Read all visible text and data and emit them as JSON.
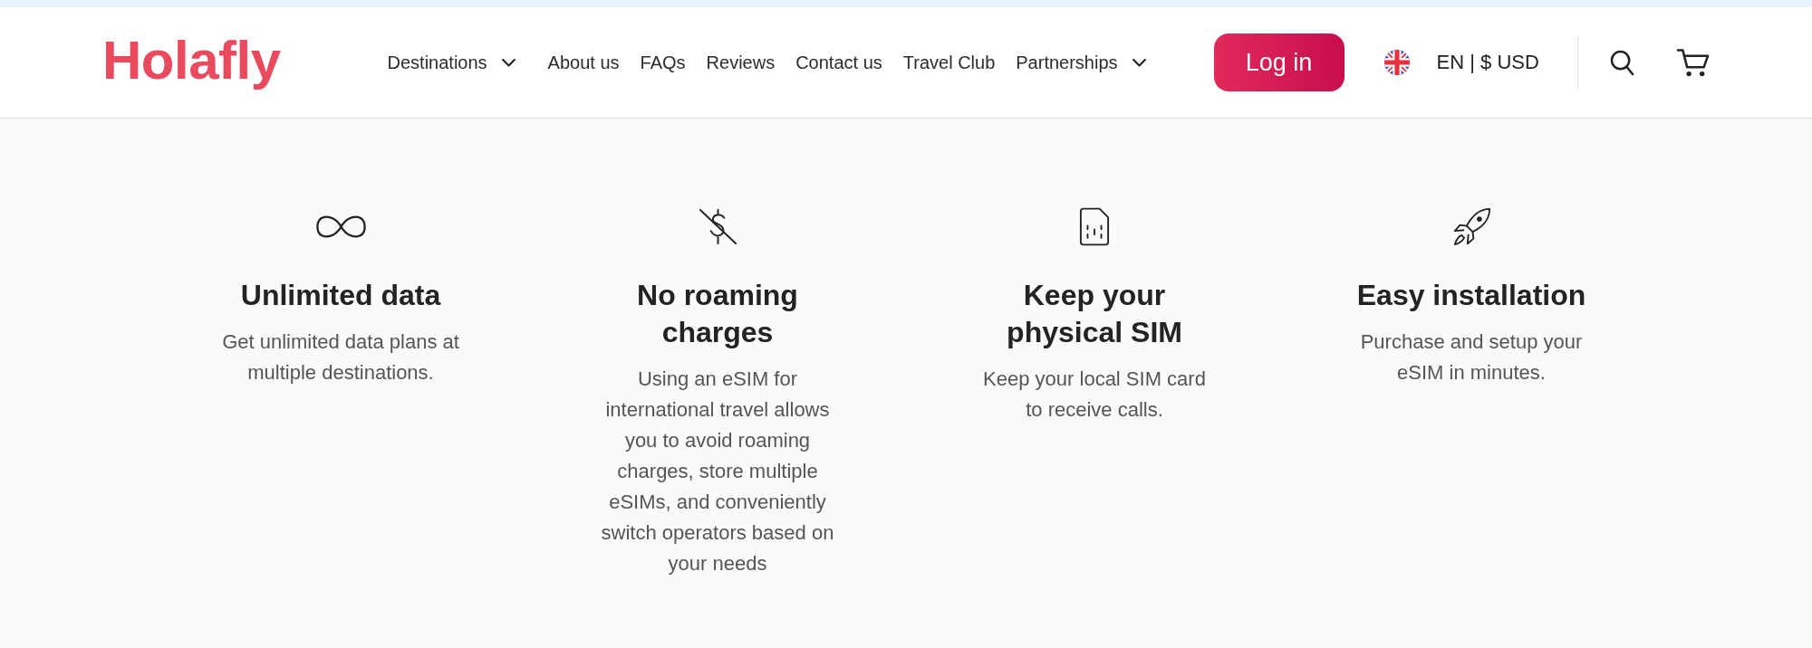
{
  "header": {
    "logo": "Holafly",
    "nav": [
      {
        "label": "Destinations",
        "kind": "dropdown"
      },
      {
        "label": "About us",
        "kind": "link"
      },
      {
        "label": "FAQs",
        "kind": "link"
      },
      {
        "label": "Reviews",
        "kind": "link"
      },
      {
        "label": "Contact us",
        "kind": "link"
      },
      {
        "label": "Travel Club",
        "kind": "link"
      },
      {
        "label": "Partnerships",
        "kind": "dropdown"
      }
    ],
    "login_button": "Log in",
    "locale": "EN | $ USD"
  },
  "features": [
    {
      "title": "Unlimited data",
      "description": "Get unlimited data plans at multiple destinations."
    },
    {
      "title": "No roaming charges",
      "description": "Using an eSIM for international travel allows you to avoid roaming charges, store multiple eSIMs, and conveniently switch operators based on your needs"
    },
    {
      "title": "Keep your physical SIM",
      "description": "Keep your local SIM card to receive calls."
    },
    {
      "title": "Easy installation",
      "description": "Purchase and setup your eSIM in minutes."
    }
  ]
}
